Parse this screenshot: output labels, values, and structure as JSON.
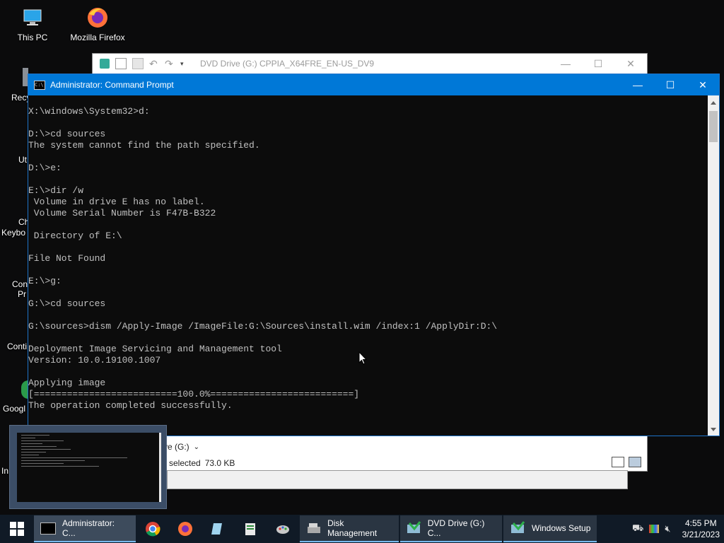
{
  "desktop": {
    "icons": [
      {
        "label": "This PC",
        "icon": "this-pc-icon"
      },
      {
        "label": "Mozilla Firefox",
        "icon": "firefox-icon"
      }
    ],
    "partial_labels": [
      "Recy",
      "Ut",
      "Ch",
      "Keybo",
      "Con",
      "Pr",
      "Conti",
      "Googl",
      "In"
    ]
  },
  "explorer": {
    "title": "DVD Drive (G:) CPPIA_X64FRE_EN-US_DV9",
    "address_fragment": "ve (G:)",
    "status_selected": "selected",
    "status_size": "73.0 KB"
  },
  "cmd": {
    "title": "Administrator: Command Prompt",
    "lines": [
      "X:\\windows\\System32>d:",
      "",
      "D:\\>cd sources",
      "The system cannot find the path specified.",
      "",
      "D:\\>e:",
      "",
      "E:\\>dir /w",
      " Volume in drive E has no label.",
      " Volume Serial Number is F47B-B322",
      "",
      " Directory of E:\\",
      "",
      "File Not Found",
      "",
      "E:\\>g:",
      "",
      "G:\\>cd sources",
      "",
      "G:\\sources>dism /Apply-Image /ImageFile:G:\\Sources\\install.wim /index:1 /ApplyDir:D:\\",
      "",
      "Deployment Image Servicing and Management tool",
      "Version: 10.0.19100.1007",
      "",
      "Applying image",
      "[==========================100.0%==========================]",
      "The operation completed successfully."
    ]
  },
  "taskbar": {
    "items": [
      {
        "label": "Administrator: C...",
        "icon": "cmd-icon"
      },
      {
        "label": "",
        "icon": "chrome-icon"
      },
      {
        "label": "",
        "icon": "firefox-icon"
      },
      {
        "label": "",
        "icon": "notepad-icon"
      },
      {
        "label": "",
        "icon": "editor-icon"
      },
      {
        "label": "",
        "icon": "paint-icon"
      },
      {
        "label": "Disk Management",
        "icon": "disk-management-icon"
      },
      {
        "label": "DVD Drive (G:) C...",
        "icon": "dvd-drive-icon"
      },
      {
        "label": "Windows Setup",
        "icon": "windows-setup-icon"
      }
    ],
    "time": "4:55 PM",
    "date": "3/21/2023"
  },
  "colors": {
    "accent": "#0078d7",
    "console_bg": "#0c0c0c",
    "console_text": "#c0c0c0",
    "taskbar": "#101a26"
  }
}
